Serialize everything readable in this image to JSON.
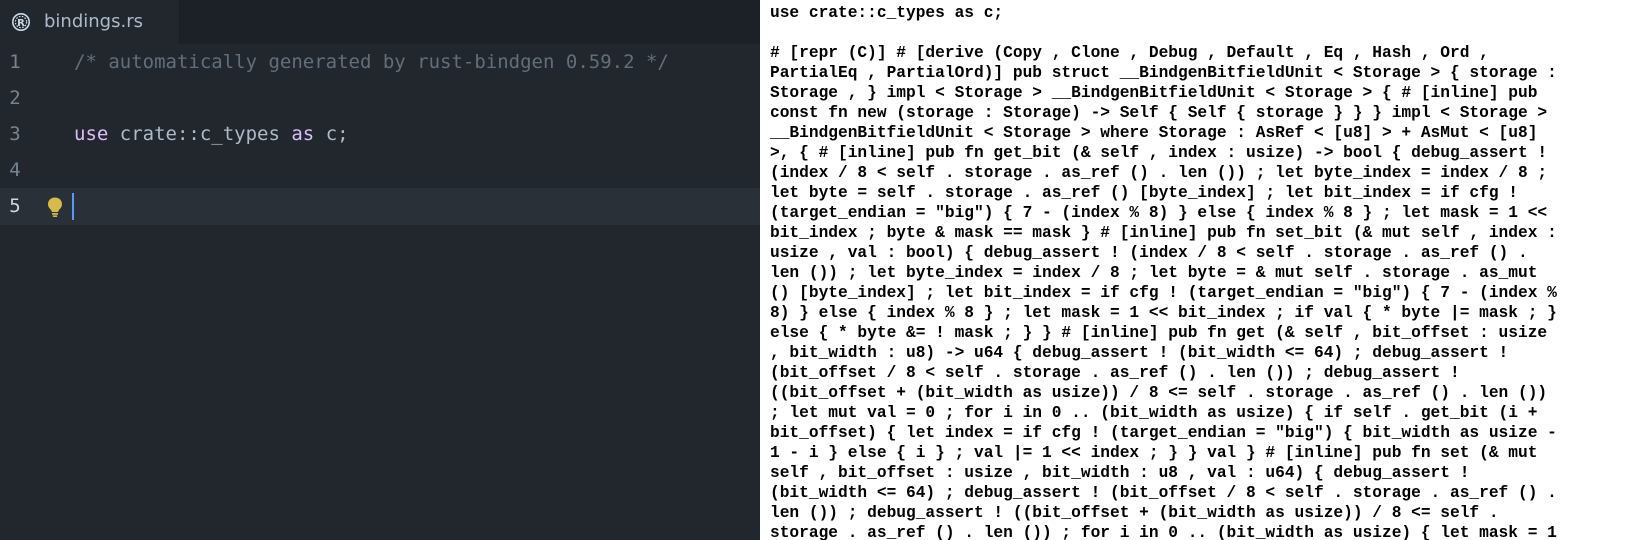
{
  "tab": {
    "filename": "bindings.rs",
    "icon": "rust-icon"
  },
  "editor": {
    "lines": [
      {
        "number": "1",
        "comment": "/* automatically generated by rust-bindgen 0.59.2 */"
      },
      {
        "number": "2"
      },
      {
        "number": "3",
        "kw_use": "use",
        "path": " crate::c_types ",
        "kw_as": "as",
        "rest": " c;"
      },
      {
        "number": "4"
      },
      {
        "number": "5"
      }
    ],
    "active_line": "5"
  },
  "colors": {
    "editor_bg": "#22272e",
    "comment": "#636e7b",
    "keyword": "#dcbdfb",
    "caret": "#539bf5",
    "bulb": "#d7ba4b"
  },
  "output": {
    "lines": [
      "use crate::c_types as c;",
      "",
      "# [repr (C)] # [derive (Copy , Clone , Debug , Default , Eq , Hash , Ord ,",
      "PartialEq , PartialOrd)] pub struct __BindgenBitfieldUnit < Storage > { storage :",
      "Storage , } impl < Storage > __BindgenBitfieldUnit < Storage > { # [inline] pub",
      "const fn new (storage : Storage) -> Self { Self { storage } } } impl < Storage >",
      "__BindgenBitfieldUnit < Storage > where Storage : AsRef < [u8] > + AsMut < [u8]",
      ">, { # [inline] pub fn get_bit (& self , index : usize) -> bool { debug_assert !",
      "(index / 8 < self . storage . as_ref () . len ()) ; let byte_index = index / 8 ;",
      "let byte = self . storage . as_ref () [byte_index] ; let bit_index = if cfg !",
      "(target_endian = \"big\") { 7 - (index % 8) } else { index % 8 } ; let mask = 1 <<",
      "bit_index ; byte & mask == mask } # [inline] pub fn set_bit (& mut self , index :",
      "usize , val : bool) { debug_assert ! (index / 8 < self . storage . as_ref () .",
      "len ()) ; let byte_index = index / 8 ; let byte = & mut self . storage . as_mut",
      "() [byte_index] ; let bit_index = if cfg ! (target_endian = \"big\") { 7 - (index %",
      "8) } else { index % 8 } ; let mask = 1 << bit_index ; if val { * byte |= mask ; }",
      "else { * byte &= ! mask ; } } # [inline] pub fn get (& self , bit_offset : usize",
      ", bit_width : u8) -> u64 { debug_assert ! (bit_width <= 64) ; debug_assert !",
      "(bit_offset / 8 < self . storage . as_ref () . len ()) ; debug_assert !",
      "((bit_offset + (bit_width as usize)) / 8 <= self . storage . as_ref () . len ())",
      "; let mut val = 0 ; for i in 0 .. (bit_width as usize) { if self . get_bit (i +",
      "bit_offset) { let index = if cfg ! (target_endian = \"big\") { bit_width as usize -",
      "1 - i } else { i } ; val |= 1 << index ; } } val } # [inline] pub fn set (& mut",
      "self , bit_offset : usize , bit_width : u8 , val : u64) { debug_assert !",
      "(bit_width <= 64) ; debug_assert ! (bit_offset / 8 < self . storage . as_ref () .",
      "len ()) ; debug_assert ! ((bit_offset + (bit_width as usize)) / 8 <= self .",
      "storage . as_ref () . len ()) ; for i in 0 .. (bit_width as usize) { let mask = 1"
    ]
  }
}
